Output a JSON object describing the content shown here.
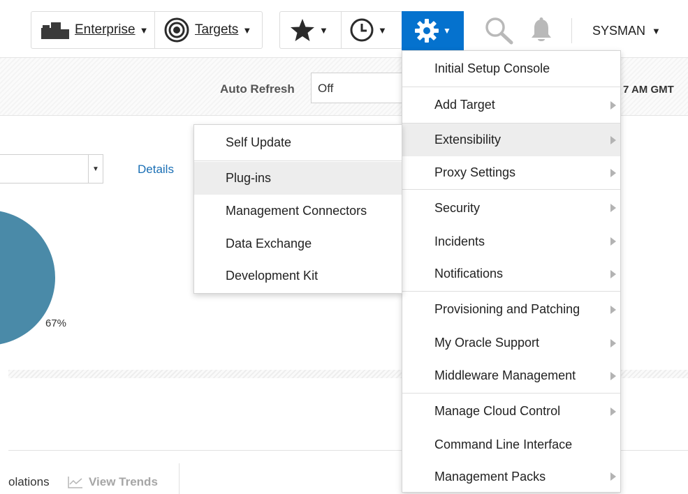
{
  "nav": {
    "enterprise_label": "Enterprise",
    "targets_label": "Targets",
    "user_label": "SYSMAN"
  },
  "refresh": {
    "label": "Auto Refresh",
    "value": "Off",
    "time_fragment": "7 AM GMT"
  },
  "content": {
    "details_link": "Details",
    "pie_percent": "67%",
    "violations_fragment": "olations",
    "view_trends_label": "View Trends"
  },
  "setup_menu": {
    "items": [
      {
        "label": "Initial Setup Console"
      },
      {
        "label": "Add Target"
      },
      {
        "label": "Extensibility"
      },
      {
        "label": "Proxy Settings"
      },
      {
        "label": "Security"
      },
      {
        "label": "Incidents"
      },
      {
        "label": "Notifications"
      },
      {
        "label": "Provisioning and Patching"
      },
      {
        "label": "My Oracle Support"
      },
      {
        "label": "Middleware Management"
      },
      {
        "label": "Manage Cloud Control"
      },
      {
        "label": "Command Line Interface"
      },
      {
        "label": "Management Packs"
      }
    ]
  },
  "extensibility_menu": {
    "items": [
      {
        "label": "Self Update"
      },
      {
        "label": "Plug-ins"
      },
      {
        "label": "Management Connectors"
      },
      {
        "label": "Data Exchange"
      },
      {
        "label": "Development Kit"
      }
    ]
  },
  "colors": {
    "accent": "#0572ce",
    "link": "#1a6fb5",
    "pie": "#4a8aa8",
    "highlight": "#ededed"
  }
}
